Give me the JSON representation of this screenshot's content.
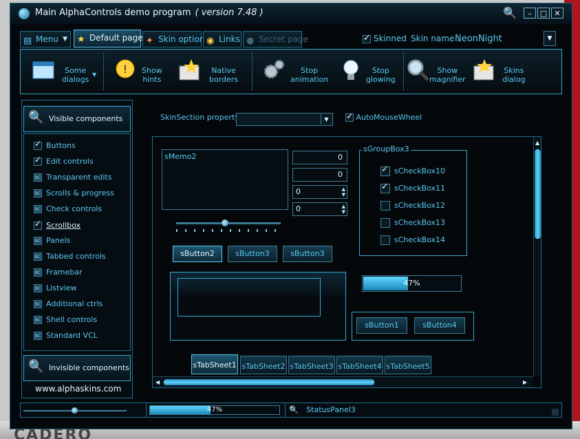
{
  "window": {
    "title": "Main AlphaControls demo program",
    "version": "( version 7.48 )"
  },
  "tabs": [
    {
      "label": "Menu",
      "icon": "menu-icon"
    },
    {
      "label": "Default page",
      "icon": "star-icon"
    },
    {
      "label": "Skin options",
      "icon": "wand-icon"
    },
    {
      "label": "Links",
      "icon": "links-icon"
    },
    {
      "label": "Secret page",
      "icon": "lock-icon"
    }
  ],
  "skin": {
    "skinned_label": "Skinned",
    "name_label": "Skin name :",
    "name_value": "NeonNight"
  },
  "toolbar": [
    {
      "label": "Some\ndialogs",
      "icon": "window-icon"
    },
    {
      "label": "Show\nhints",
      "icon": "lightbulb-hint-icon"
    },
    {
      "label": "Native\nborders",
      "icon": "folder-star-icon"
    },
    {
      "label": "Stop\nanimation",
      "icon": "gears-icon"
    },
    {
      "label": "Stop\nglowing",
      "icon": "bulb-icon"
    },
    {
      "label": "Show\nmagnifier",
      "icon": "magnifier-icon"
    },
    {
      "label": "Skins\ndialog",
      "icon": "skins-icon"
    }
  ],
  "sidebar": {
    "visible_header": "Visible components",
    "invisible_header": "Invisible components",
    "items": [
      {
        "label": "Buttons",
        "checked": true
      },
      {
        "label": "Edit controls",
        "checked": true
      },
      {
        "label": "Transparent edits",
        "checked": false
      },
      {
        "label": "Scrolls & progress",
        "checked": false
      },
      {
        "label": "Check controls",
        "checked": false
      },
      {
        "label": "Scrollbox",
        "checked": true
      },
      {
        "label": "Panels",
        "checked": false
      },
      {
        "label": "Tabbed controls",
        "checked": false
      },
      {
        "label": "Framebar",
        "checked": false
      },
      {
        "label": "Listview",
        "checked": false
      },
      {
        "label": "Additional ctrls",
        "checked": false
      },
      {
        "label": "Shell controls",
        "checked": false
      },
      {
        "label": "Standard VCL",
        "checked": false
      }
    ],
    "site": "www.alphaskins.com"
  },
  "content": {
    "skinsection_label": "SkinSection property :",
    "skinsection_value": "",
    "automousewheel_label": "AutoMouseWheel",
    "memo_text": "sMemo2",
    "num1": "0",
    "num2": "0",
    "spin1": "0",
    "spin2": "0",
    "buttons_row": [
      "sButton2",
      "sButton3",
      "sButton3"
    ],
    "groupbox": {
      "title": "sGroupBox3",
      "items": [
        {
          "label": "sCheckBox10",
          "checked": true
        },
        {
          "label": "sCheckBox11",
          "checked": true
        },
        {
          "label": "sCheckBox12",
          "checked": false
        },
        {
          "label": "sCheckBox13",
          "checked": false
        },
        {
          "label": "sCheckBox14",
          "checked": false
        }
      ]
    },
    "progress": {
      "value": 0.47,
      "text": "47%"
    },
    "buttons_panel": [
      "sButton1",
      "sButton4"
    ],
    "tabsheets": [
      "sTabSheet1",
      "sTabSheet2",
      "sTabSheet3",
      "sTabSheet4",
      "sTabSheet5"
    ]
  },
  "statusbar": {
    "progress_value": 0.47,
    "progress_text": "47%",
    "panel3": "StatusPanel3"
  },
  "colors": {
    "accent": "#5ac8f0",
    "background": "#05080b",
    "border": "#3aa6d0"
  }
}
